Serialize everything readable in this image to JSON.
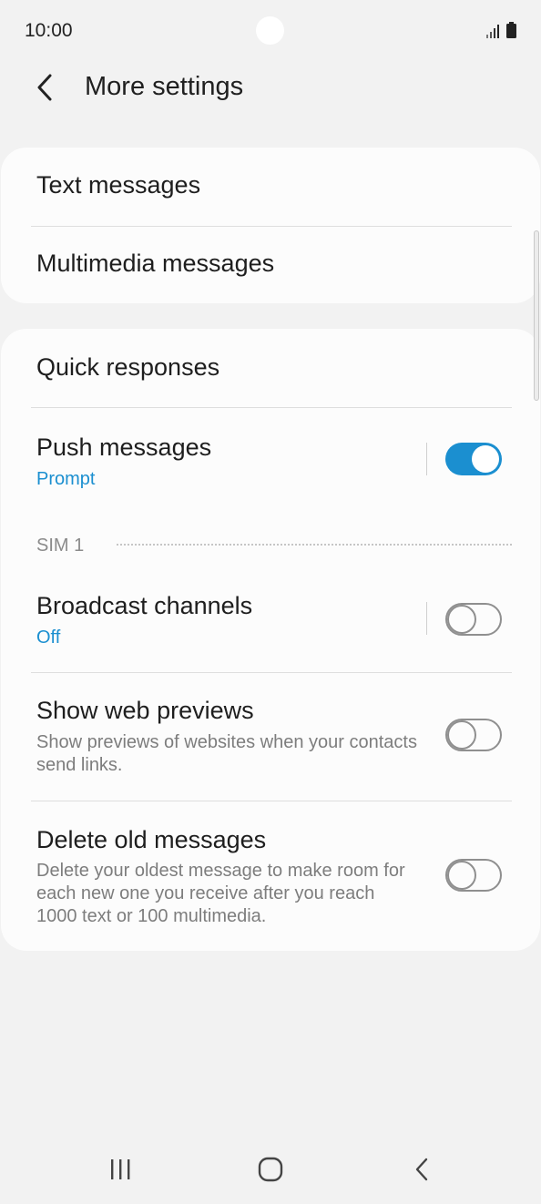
{
  "status_bar": {
    "time": "10:00",
    "icons": [
      "signal-icon",
      "battery-icon"
    ]
  },
  "header": {
    "title": "More settings",
    "back_icon": "chevron-left-icon"
  },
  "card_1": {
    "items": [
      {
        "title": "Text messages"
      },
      {
        "title": "Multimedia messages"
      }
    ]
  },
  "card_2": {
    "quick_responses": {
      "title": "Quick responses"
    },
    "push_messages": {
      "title": "Push messages",
      "subtitle": "Prompt",
      "toggle": "on"
    },
    "section_label": "SIM 1",
    "broadcast_channels": {
      "title": "Broadcast channels",
      "subtitle": "Off",
      "toggle": "off"
    },
    "show_web_previews": {
      "title": "Show web previews",
      "subtitle": "Show previews of websites when your contacts send links.",
      "toggle": "off"
    },
    "delete_old_messages": {
      "title": "Delete old messages",
      "subtitle": "Delete your oldest message to make room for each new one you receive after you reach 1000 text or 100 multimedia.",
      "toggle": "off"
    }
  },
  "nav_bar": {
    "icons": [
      "recent-apps-icon",
      "home-icon",
      "back-icon"
    ]
  },
  "colors": {
    "accent": "#1b8fd0",
    "background": "#f2f2f2",
    "card": "#fcfcfc"
  }
}
